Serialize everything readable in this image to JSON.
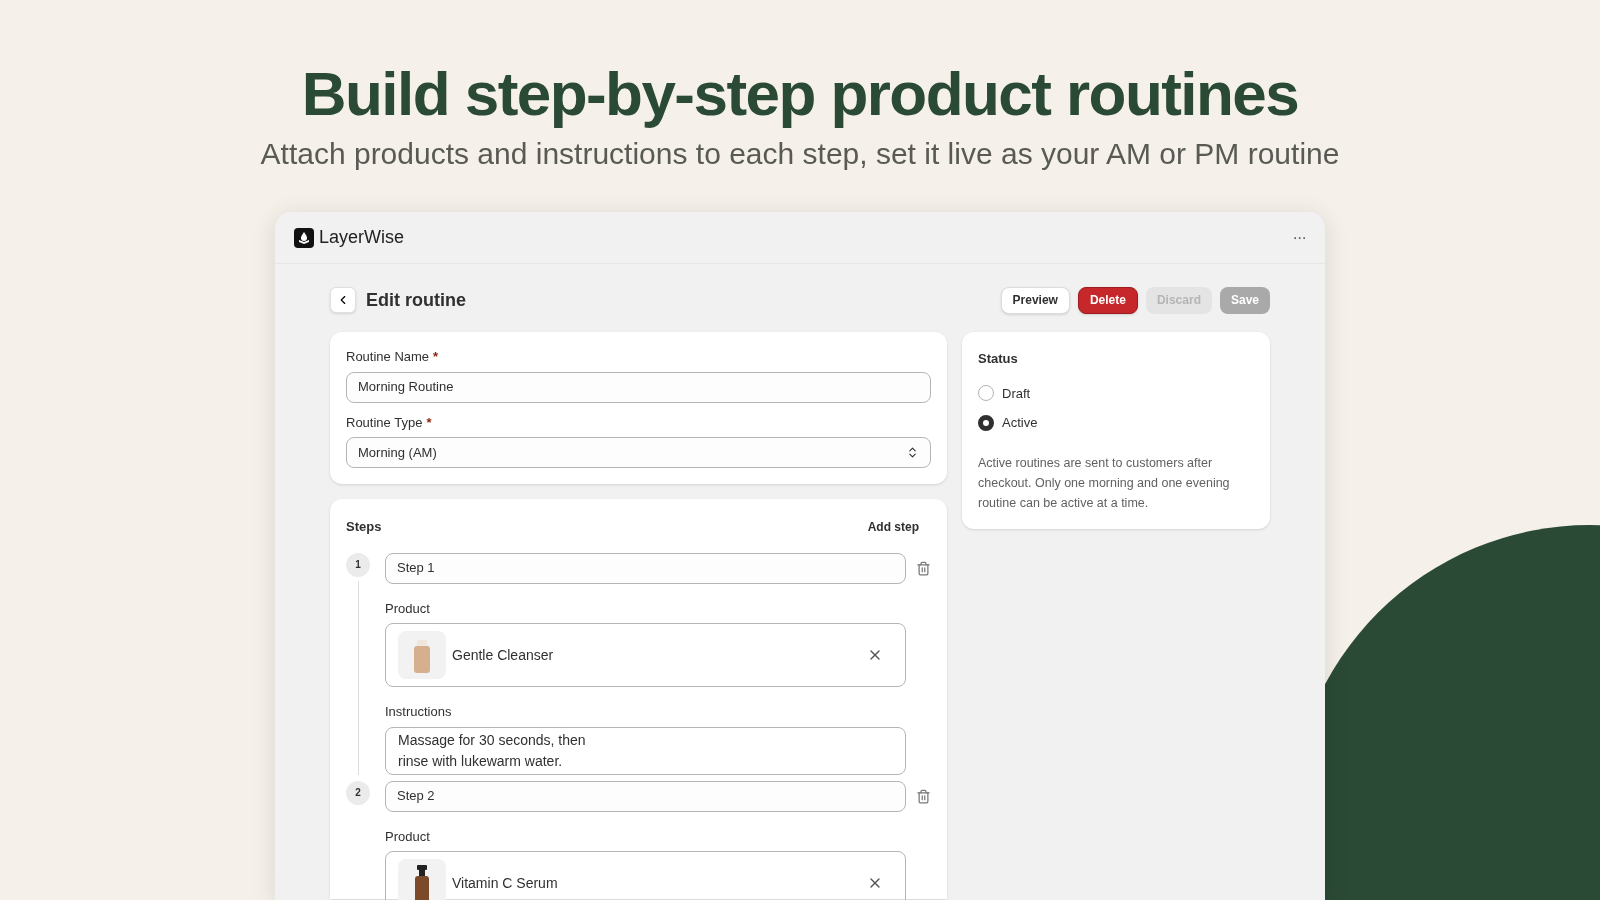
{
  "hero": {
    "title": "Build step-by-step product routines",
    "subtitle": "Attach products and instructions to each step, set it live as your AM or PM routine"
  },
  "app": {
    "name": "LayerWise",
    "menu": "···"
  },
  "page": {
    "title": "Edit routine"
  },
  "actions": [
    {
      "label": "Preview",
      "kind": "secondary",
      "disabled": false
    },
    {
      "label": "Delete",
      "kind": "danger",
      "disabled": false
    },
    {
      "label": "Discard",
      "kind": "secondary",
      "disabled": true
    },
    {
      "label": "Save",
      "kind": "primary",
      "disabled": true
    }
  ],
  "details": {
    "fields": [
      {
        "label": "Routine Name",
        "required_mark": "*",
        "kind": "text",
        "value": "Morning Routine"
      },
      {
        "label": "Routine Type",
        "required_mark": "*",
        "kind": "select",
        "value": "Morning (AM)"
      }
    ]
  },
  "steps": {
    "title": "Steps",
    "add_label": "Add step",
    "items": [
      {
        "number": "1",
        "name": "Step 1",
        "product_label": "Product",
        "product": "Gentle Cleanser",
        "instructions_label": "Instructions",
        "instructions": "Massage for 30 seconds, then\nrinse with lukewarm water."
      },
      {
        "number": "2",
        "name": "Step 2",
        "product_label": "Product",
        "product": "Vitamin C Serum"
      }
    ]
  },
  "status": {
    "title": "Status",
    "options": [
      {
        "label": "Draft",
        "selected": false
      },
      {
        "label": "Active",
        "selected": true
      }
    ],
    "help": "Active routines are sent to customers after checkout. Only one morning and one evening routine can be active at a time."
  }
}
